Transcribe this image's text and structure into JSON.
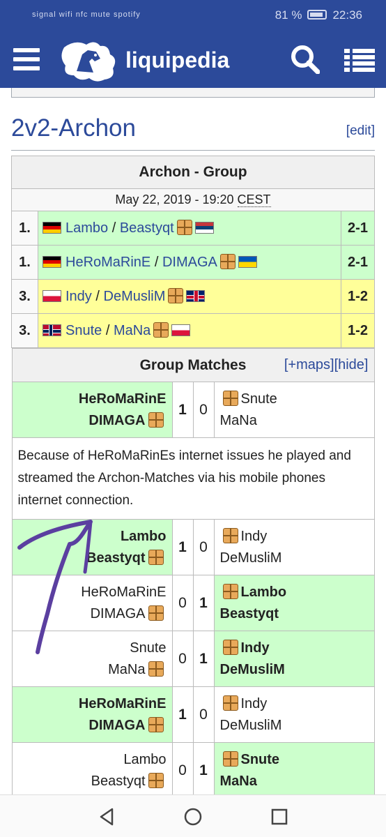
{
  "status_bar": {
    "left_icons": "signal wifi nfc mute spotify",
    "right_text": "81 %",
    "time": "22:36"
  },
  "header": {
    "brand": "liquipedia",
    "menu_icon": "hamburger-icon",
    "search_icon": "search-icon",
    "list_icon": "list-icon"
  },
  "section": {
    "title": "2v2-Archon",
    "edit_label": "[edit]"
  },
  "group": {
    "title": "Archon - Group",
    "date": "May 22, 2019 - 19:20 ",
    "timezone": "CEST",
    "standings": [
      {
        "rank": "1.",
        "p1": "Lambo",
        "p2": "Beastyqt",
        "score": "2-1"
      },
      {
        "rank": "1.",
        "p1": "HeRoMaRinE",
        "p2": "DIMAGA",
        "score": "2-1"
      },
      {
        "rank": "3.",
        "p1": "Indy",
        "p2": "DeMusliM",
        "score": "1-2"
      },
      {
        "rank": "3.",
        "p1": "Snute",
        "p2": "MaNa",
        "score": "1-2"
      }
    ],
    "sep": "/",
    "matches_title": "Group Matches",
    "maps_label": "[+maps]",
    "hide_label": "[hide]",
    "matches": [
      {
        "l1": "HeRoMaRinE",
        "l2": "DIMAGA",
        "ls": "1",
        "rs": "0",
        "r1": "Snute",
        "r2": "MaNa"
      },
      {
        "l1": "Lambo",
        "l2": "Beastyqt",
        "ls": "1",
        "rs": "0",
        "r1": "Indy",
        "r2": "DeMusliM"
      },
      {
        "l1": "HeRoMaRinE",
        "l2": "DIMAGA",
        "ls": "0",
        "rs": "1",
        "r1": "Lambo",
        "r2": "Beastyqt"
      },
      {
        "l1": "Snute",
        "l2": "MaNa",
        "ls": "0",
        "rs": "1",
        "r1": "Indy",
        "r2": "DeMusliM"
      },
      {
        "l1": "HeRoMaRinE",
        "l2": "DIMAGA",
        "ls": "1",
        "rs": "0",
        "r1": "Indy",
        "r2": "DeMusliM"
      },
      {
        "l1": "Lambo",
        "l2": "Beastyqt",
        "ls": "0",
        "rs": "1",
        "r1": "Snute",
        "r2": "MaNa"
      }
    ],
    "comment": "Because of HeRoMaRinEs internet issues he played and streamed the Archon-Matches via his mobile phones internet connection."
  },
  "colors": {
    "brand": "#2c4a9a",
    "win": "#ccffcc",
    "mid": "#ffff99",
    "scribble": "#5b3fa0"
  }
}
